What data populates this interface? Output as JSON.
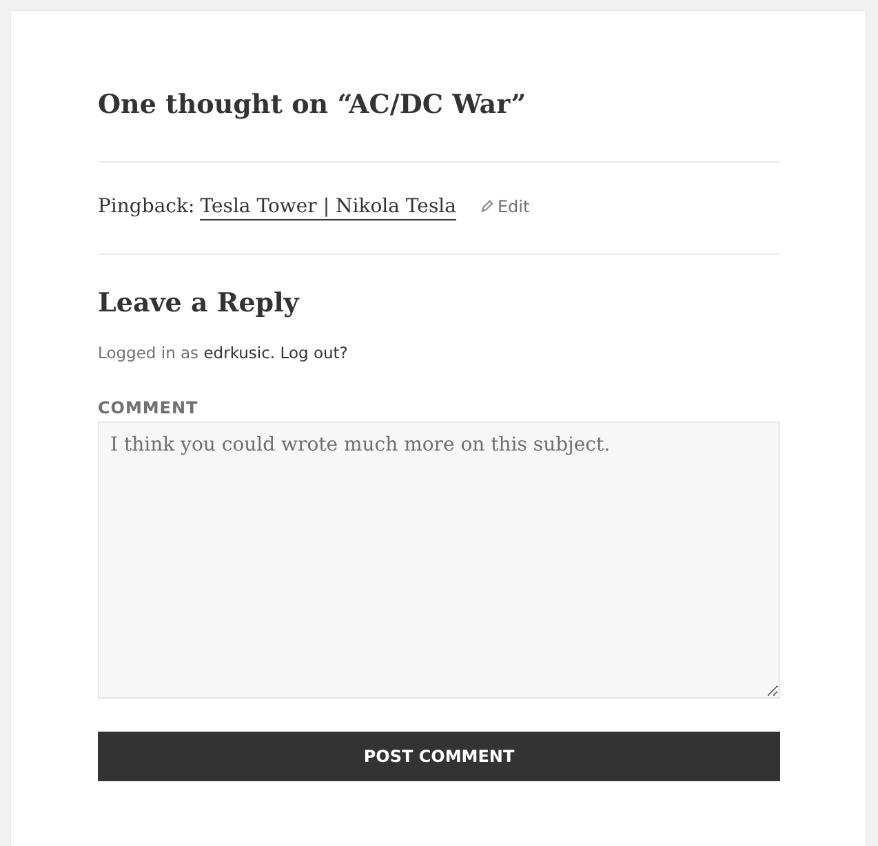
{
  "comments_title": "One thought on “AC/DC War”",
  "pingback": {
    "label": "Pingback:",
    "link": "Tesla Tower | Nikola Tesla",
    "edit": "Edit"
  },
  "reply": {
    "title": "Leave a Reply",
    "logged_in_prefix": "Logged in as",
    "user": "edrkusic.",
    "logout": "Log out?",
    "comment_label": "COMMENT",
    "comment_value": "I think you could wrote much more on this subject.",
    "submit": "POST COMMENT"
  }
}
